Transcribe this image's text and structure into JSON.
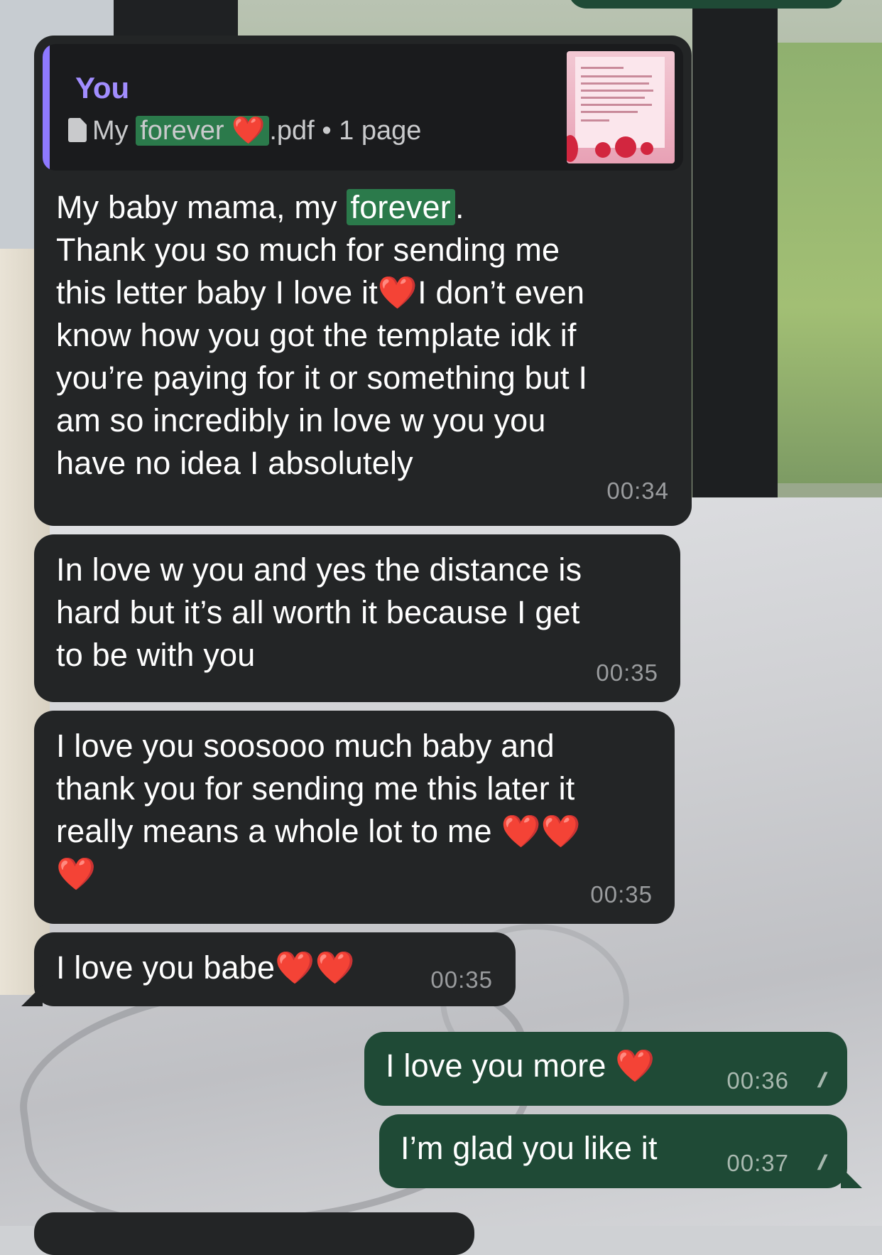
{
  "quote": {
    "author": "You",
    "file_prefix": "My ",
    "file_highlight": "forever ❤️",
    "file_suffix": ".pdf",
    "file_meta": "• 1 page"
  },
  "messages": [
    {
      "id": "m1",
      "direction": "incoming",
      "line1_pre": "My baby mama, my ",
      "line1_highlight": "forever",
      "line1_post": ".",
      "body": "Thank you so much for sending me\nthis letter baby I love it❤️I don’t even\nknow how you got the template idk if\nyou’re paying for it or something but I\nam so incredibly in love w you you\nhave no idea I absolutely",
      "time": "00:34"
    },
    {
      "id": "m2",
      "direction": "incoming",
      "body": "In love w you and yes the distance is\nhard but it’s all worth it because I get\nto be with you",
      "time": "00:35"
    },
    {
      "id": "m3",
      "direction": "incoming",
      "body": "I love you soosooo much baby and\nthank you for sending me this later it\nreally means a whole lot to me ❤️❤️\n❤️",
      "time": "00:35"
    },
    {
      "id": "m4",
      "direction": "incoming",
      "body": "I love you babe❤️❤️",
      "time": "00:35"
    },
    {
      "id": "m5",
      "direction": "outgoing",
      "body": "I love you more ❤️",
      "time": "00:36",
      "status": "read"
    },
    {
      "id": "m6",
      "direction": "outgoing",
      "body": "I’m glad you like it",
      "time": "00:37",
      "status": "read"
    }
  ],
  "ticks": "//",
  "colors": {
    "incoming_bubble": "#232526",
    "outgoing_bubble": "#1f4a36",
    "highlight": "#2b7a4b",
    "quote_accent": "#8e79ff"
  }
}
